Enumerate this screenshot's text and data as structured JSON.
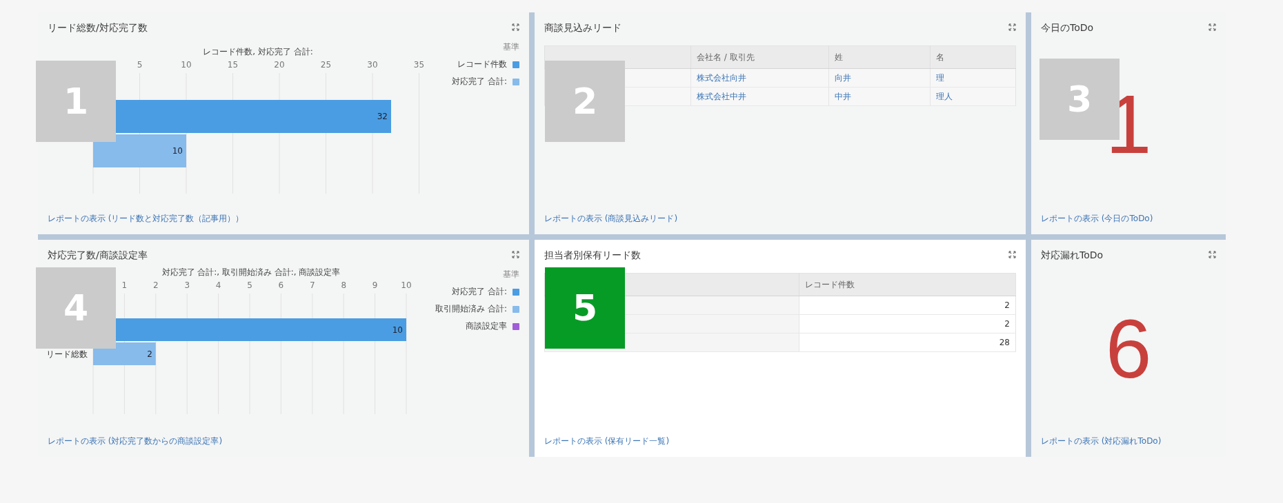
{
  "panels": [
    {
      "kind": "chart",
      "title": "リード総数/対応完了数",
      "marker": {
        "label": "1",
        "color": "#cbcbcb"
      },
      "legend_title": "基準",
      "chart_data": {
        "type": "bar",
        "orientation": "horizontal",
        "title": "レコード件数, 対応完了 合計:",
        "xticks": [
          5,
          10,
          15,
          20,
          25,
          30,
          35
        ],
        "xlim": [
          0,
          35
        ],
        "grid": true,
        "legend": "right",
        "data_labels": true,
        "series": [
          {
            "name": "レコード件数",
            "color": "#4a9de2",
            "values": [
              32
            ]
          },
          {
            "name": "対応完了 合計:",
            "color": "#86bbeb",
            "values": [
              10
            ]
          }
        ]
      },
      "footer_link": "レポートの表示 (リード数と対応完了数（記事用））"
    },
    {
      "kind": "table",
      "title": "商談見込みリード",
      "marker": {
        "label": "2",
        "color": "#cbcbcb"
      },
      "columns": [
        "会社名 / 取引先",
        "姓",
        "名"
      ],
      "rows": [
        {
          "cells": [
            "株式会社向井",
            "向井",
            "理"
          ]
        },
        {
          "cells": [
            "株式会社中井",
            "中井",
            "理人"
          ]
        }
      ],
      "footer_link": "レポートの表示 (商談見込みリード)"
    },
    {
      "kind": "metric",
      "title": "今日のToDo",
      "marker": {
        "label": "3",
        "color": "#cbcbcb"
      },
      "value": "1",
      "footer_link": "レポートの表示 (今日のToDo)"
    },
    {
      "kind": "chart",
      "title": "対応完了数/商談設定率",
      "marker": {
        "label": "4",
        "color": "#cbcbcb"
      },
      "legend_title": "基準",
      "chart_data": {
        "type": "bar",
        "orientation": "horizontal",
        "title": "対応完了 合計:, 取引開始済み 合計:, 商談設定率",
        "categories": [
          "リード総数"
        ],
        "xticks": [
          1,
          2,
          3,
          4,
          5,
          6,
          7,
          8,
          9,
          10
        ],
        "xlim": [
          0,
          10
        ],
        "grid": true,
        "legend": "right",
        "data_labels": true,
        "series": [
          {
            "name": "対応完了 合計:",
            "color": "#4a9de2",
            "values": [
              10
            ]
          },
          {
            "name": "取引開始済み 合計:",
            "color": "#86bbeb",
            "values": [
              2
            ]
          },
          {
            "name": "商談設定率",
            "color": "#a05fd8",
            "values": [
              null
            ]
          }
        ]
      },
      "footer_link": "レポートの表示 (対応完了数からの商談設定率)"
    },
    {
      "kind": "table",
      "title": "担当者別保有リード数",
      "marker": {
        "label": "5",
        "color": "#069b25"
      },
      "columns": [
        "レコード件数"
      ],
      "rows": [
        {
          "cells": [
            "2"
          ]
        },
        {
          "cells": [
            "2"
          ]
        },
        {
          "cells": [
            "28"
          ]
        }
      ],
      "footer_link": "レポートの表示 (保有リード一覧)"
    },
    {
      "kind": "metric",
      "title": "対応漏れToDo",
      "value": "6",
      "footer_link": "レポートの表示 (対応漏れToDo)"
    }
  ]
}
